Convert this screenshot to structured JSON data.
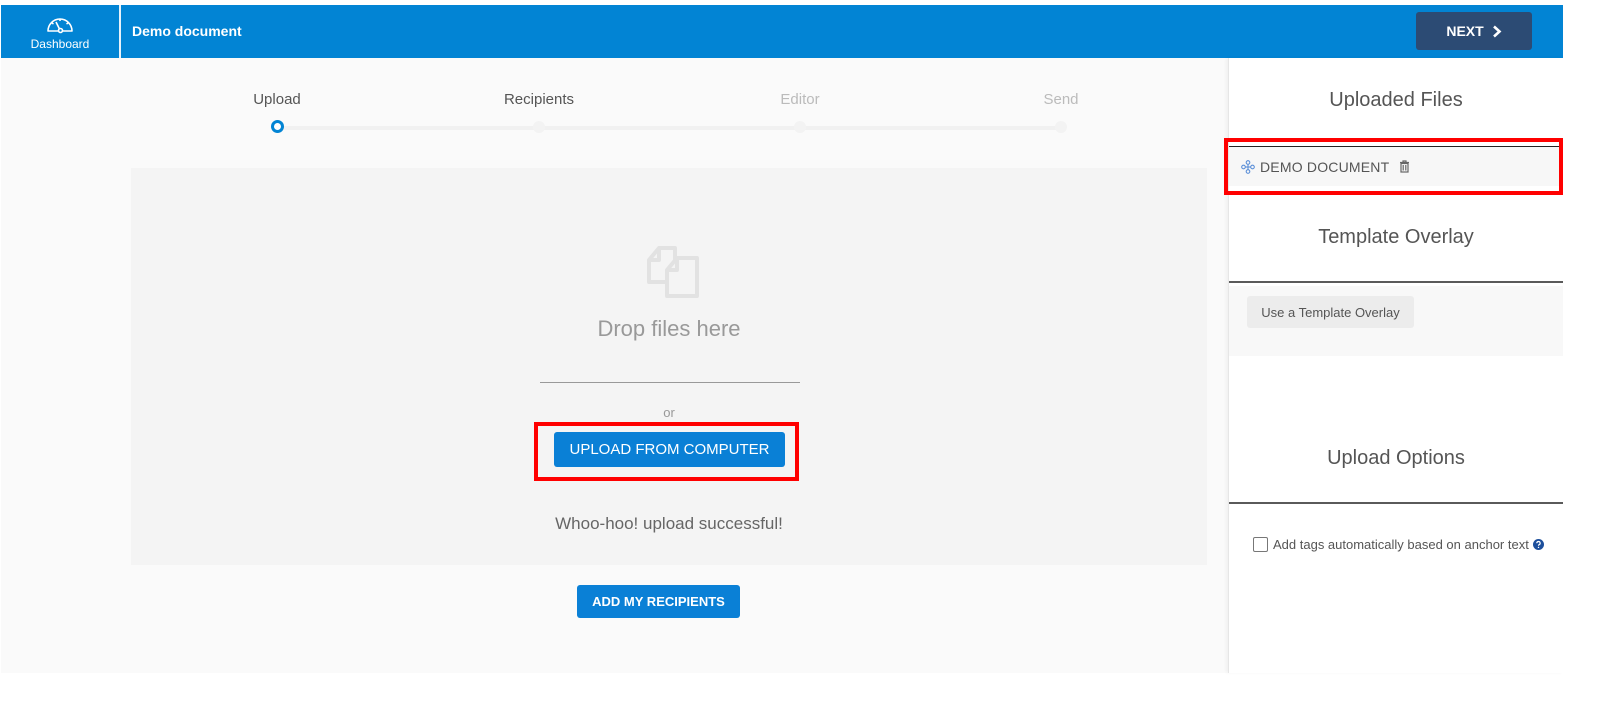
{
  "header": {
    "dashboard_label": "Dashboard",
    "document_title": "Demo document",
    "next_label": "NEXT",
    "brand_color": "#0284d4",
    "next_button_color": "#2c4b74"
  },
  "stepper": {
    "steps": [
      {
        "label": "Upload",
        "state": "active"
      },
      {
        "label": "Recipients",
        "state": "enabled"
      },
      {
        "label": "Editor",
        "state": "disabled"
      },
      {
        "label": "Send",
        "state": "disabled"
      }
    ]
  },
  "dropzone": {
    "icon": "files-icon",
    "drop_text": "Drop files here",
    "or_text": "or",
    "upload_button_label": "UPLOAD FROM COMPUTER",
    "status_text": "Whoo-hoo! upload successful!"
  },
  "actions": {
    "add_recipients_label": "ADD MY RECIPIENTS"
  },
  "sidebar": {
    "uploaded_files": {
      "heading": "Uploaded Files",
      "files": [
        {
          "name": "DEMO DOCUMENT",
          "drag_icon": "move-icon",
          "delete_icon": "trash-icon"
        }
      ]
    },
    "template_overlay": {
      "heading": "Template Overlay",
      "button_label": "Use a Template Overlay"
    },
    "upload_options": {
      "heading": "Upload Options",
      "options": [
        {
          "label": "Add tags automatically based on anchor text",
          "checked": false,
          "help_icon": "question-circle-icon"
        }
      ]
    }
  },
  "annotations": {
    "highlight_color": "#ff0000"
  }
}
